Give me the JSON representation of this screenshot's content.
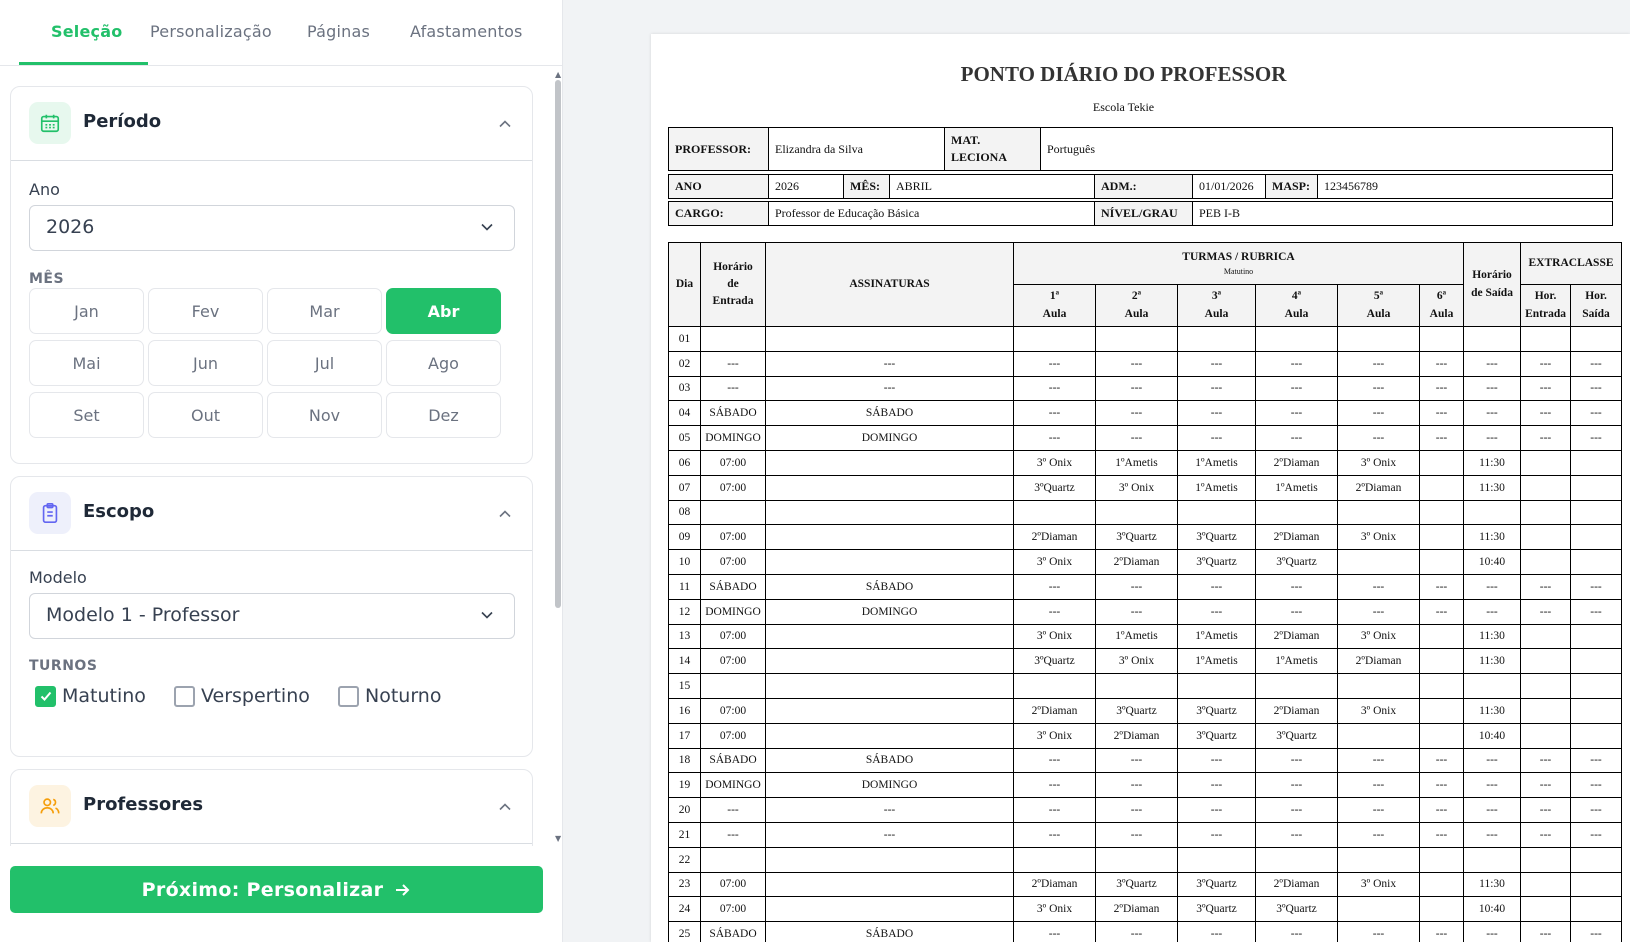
{
  "tabs": [
    "Seleção",
    "Personalização",
    "Páginas",
    "Afastamentos"
  ],
  "periodo": {
    "title": "Período",
    "ano_label": "Ano",
    "ano_value": "2026",
    "mes_label": "MÊS",
    "months": [
      "Jan",
      "Fev",
      "Mar",
      "Abr",
      "Mai",
      "Jun",
      "Jul",
      "Ago",
      "Set",
      "Out",
      "Nov",
      "Dez"
    ],
    "selected_month": "Abr"
  },
  "escopo": {
    "title": "Escopo",
    "modelo_label": "Modelo",
    "modelo_value": "Modelo 1 - Professor",
    "turnos_label": "TURNOS",
    "turnos": [
      {
        "label": "Matutino",
        "checked": true
      },
      {
        "label": "Verspertino",
        "checked": false
      },
      {
        "label": "Noturno",
        "checked": false
      }
    ]
  },
  "professores": {
    "title": "Professores"
  },
  "next_button": "Próximo: Personalizar",
  "document": {
    "title": "PONTO DIÁRIO DO PROFESSOR",
    "school": "Escola Tekie",
    "professor_label": "PROFESSOR:",
    "professor": "Elizandra da Silva",
    "mat_label_1": "MAT.",
    "mat_label_2": "LECIONA",
    "materia": "Português",
    "ano_label": "ANO",
    "ano": "2026",
    "mes_label": "MÊS:",
    "mes": "ABRIL",
    "adm_label": "ADM.:",
    "adm": "01/01/2026",
    "masp_label": "MASP:",
    "masp": "123456789",
    "cargo_label": "CARGO:",
    "cargo": "Professor de Educação Básica",
    "nivel_label": "NÍVEL/GRAU",
    "nivel": "PEB I-B",
    "headers": {
      "dia": "Dia",
      "entrada_1": "Horário",
      "entrada_2": "de",
      "entrada_3": "Entrada",
      "assinaturas": "ASSINATURAS",
      "turmas": "TURMAS / RUBRICA",
      "turno": "Matutino",
      "aulas": [
        "1ª",
        "2ª",
        "3ª",
        "4ª",
        "5ª",
        "6ª"
      ],
      "aula_word": "Aula",
      "saida_1": "Horário",
      "saida_2": "de Saída",
      "extraclasse": "EXTRACLASSE",
      "hor_entrada_1": "Hor.",
      "hor_entrada_2": "Entrada",
      "hor_saida_1": "Hor.",
      "hor_saida_2": "Saída"
    },
    "rows": [
      [
        "01",
        "",
        "",
        "",
        "",
        "",
        "",
        "",
        "",
        "",
        "",
        ""
      ],
      [
        "02",
        "---",
        "---",
        "---",
        "---",
        "---",
        "---",
        "---",
        "---",
        "---",
        "---",
        "---"
      ],
      [
        "03",
        "---",
        "---",
        "---",
        "---",
        "---",
        "---",
        "---",
        "---",
        "---",
        "---",
        "---"
      ],
      [
        "04",
        "SÁBADO",
        "SÁBADO",
        "---",
        "---",
        "---",
        "---",
        "---",
        "---",
        "---",
        "---",
        "---"
      ],
      [
        "05",
        "DOMINGO",
        "DOMINGO",
        "---",
        "---",
        "---",
        "---",
        "---",
        "---",
        "---",
        "---",
        "---"
      ],
      [
        "06",
        "07:00",
        "",
        "3º Onix",
        "1ºAmetis",
        "1ºAmetis",
        "2ºDiaman",
        "3º Onix",
        "",
        "11:30",
        "",
        ""
      ],
      [
        "07",
        "07:00",
        "",
        "3ºQuartz",
        "3º Onix",
        "1ºAmetis",
        "1ºAmetis",
        "2ºDiaman",
        "",
        "11:30",
        "",
        ""
      ],
      [
        "08",
        "",
        "",
        "",
        "",
        "",
        "",
        "",
        "",
        "",
        "",
        ""
      ],
      [
        "09",
        "07:00",
        "",
        "2ºDiaman",
        "3ºQuartz",
        "3ºQuartz",
        "2ºDiaman",
        "3º Onix",
        "",
        "11:30",
        "",
        ""
      ],
      [
        "10",
        "07:00",
        "",
        "3º Onix",
        "2ºDiaman",
        "3ºQuartz",
        "3ºQuartz",
        "",
        "",
        "10:40",
        "",
        ""
      ],
      [
        "11",
        "SÁBADO",
        "SÁBADO",
        "---",
        "---",
        "---",
        "---",
        "---",
        "---",
        "---",
        "---",
        "---"
      ],
      [
        "12",
        "DOMINGO",
        "DOMINGO",
        "---",
        "---",
        "---",
        "---",
        "---",
        "---",
        "---",
        "---",
        "---"
      ],
      [
        "13",
        "07:00",
        "",
        "3º Onix",
        "1ºAmetis",
        "1ºAmetis",
        "2ºDiaman",
        "3º Onix",
        "",
        "11:30",
        "",
        ""
      ],
      [
        "14",
        "07:00",
        "",
        "3ºQuartz",
        "3º Onix",
        "1ºAmetis",
        "1ºAmetis",
        "2ºDiaman",
        "",
        "11:30",
        "",
        ""
      ],
      [
        "15",
        "",
        "",
        "",
        "",
        "",
        "",
        "",
        "",
        "",
        "",
        ""
      ],
      [
        "16",
        "07:00",
        "",
        "2ºDiaman",
        "3ºQuartz",
        "3ºQuartz",
        "2ºDiaman",
        "3º Onix",
        "",
        "11:30",
        "",
        ""
      ],
      [
        "17",
        "07:00",
        "",
        "3º Onix",
        "2ºDiaman",
        "3ºQuartz",
        "3ºQuartz",
        "",
        "",
        "10:40",
        "",
        ""
      ],
      [
        "18",
        "SÁBADO",
        "SÁBADO",
        "---",
        "---",
        "---",
        "---",
        "---",
        "---",
        "---",
        "---",
        "---"
      ],
      [
        "19",
        "DOMINGO",
        "DOMINGO",
        "---",
        "---",
        "---",
        "---",
        "---",
        "---",
        "---",
        "---",
        "---"
      ],
      [
        "20",
        "---",
        "---",
        "---",
        "---",
        "---",
        "---",
        "---",
        "---",
        "---",
        "---",
        "---"
      ],
      [
        "21",
        "---",
        "---",
        "---",
        "---",
        "---",
        "---",
        "---",
        "---",
        "---",
        "---",
        "---"
      ],
      [
        "22",
        "",
        "",
        "",
        "",
        "",
        "",
        "",
        "",
        "",
        "",
        ""
      ],
      [
        "23",
        "07:00",
        "",
        "2ºDiaman",
        "3ºQuartz",
        "3ºQuartz",
        "2ºDiaman",
        "3º Onix",
        "",
        "11:30",
        "",
        ""
      ],
      [
        "24",
        "07:00",
        "",
        "3º Onix",
        "2ºDiaman",
        "3ºQuartz",
        "3ºQuartz",
        "",
        "",
        "10:40",
        "",
        ""
      ],
      [
        "25",
        "SÁBADO",
        "SÁBADO",
        "---",
        "---",
        "---",
        "---",
        "---",
        "---",
        "---",
        "---",
        "---"
      ]
    ]
  },
  "colors": {
    "accent": "#22c06a"
  }
}
